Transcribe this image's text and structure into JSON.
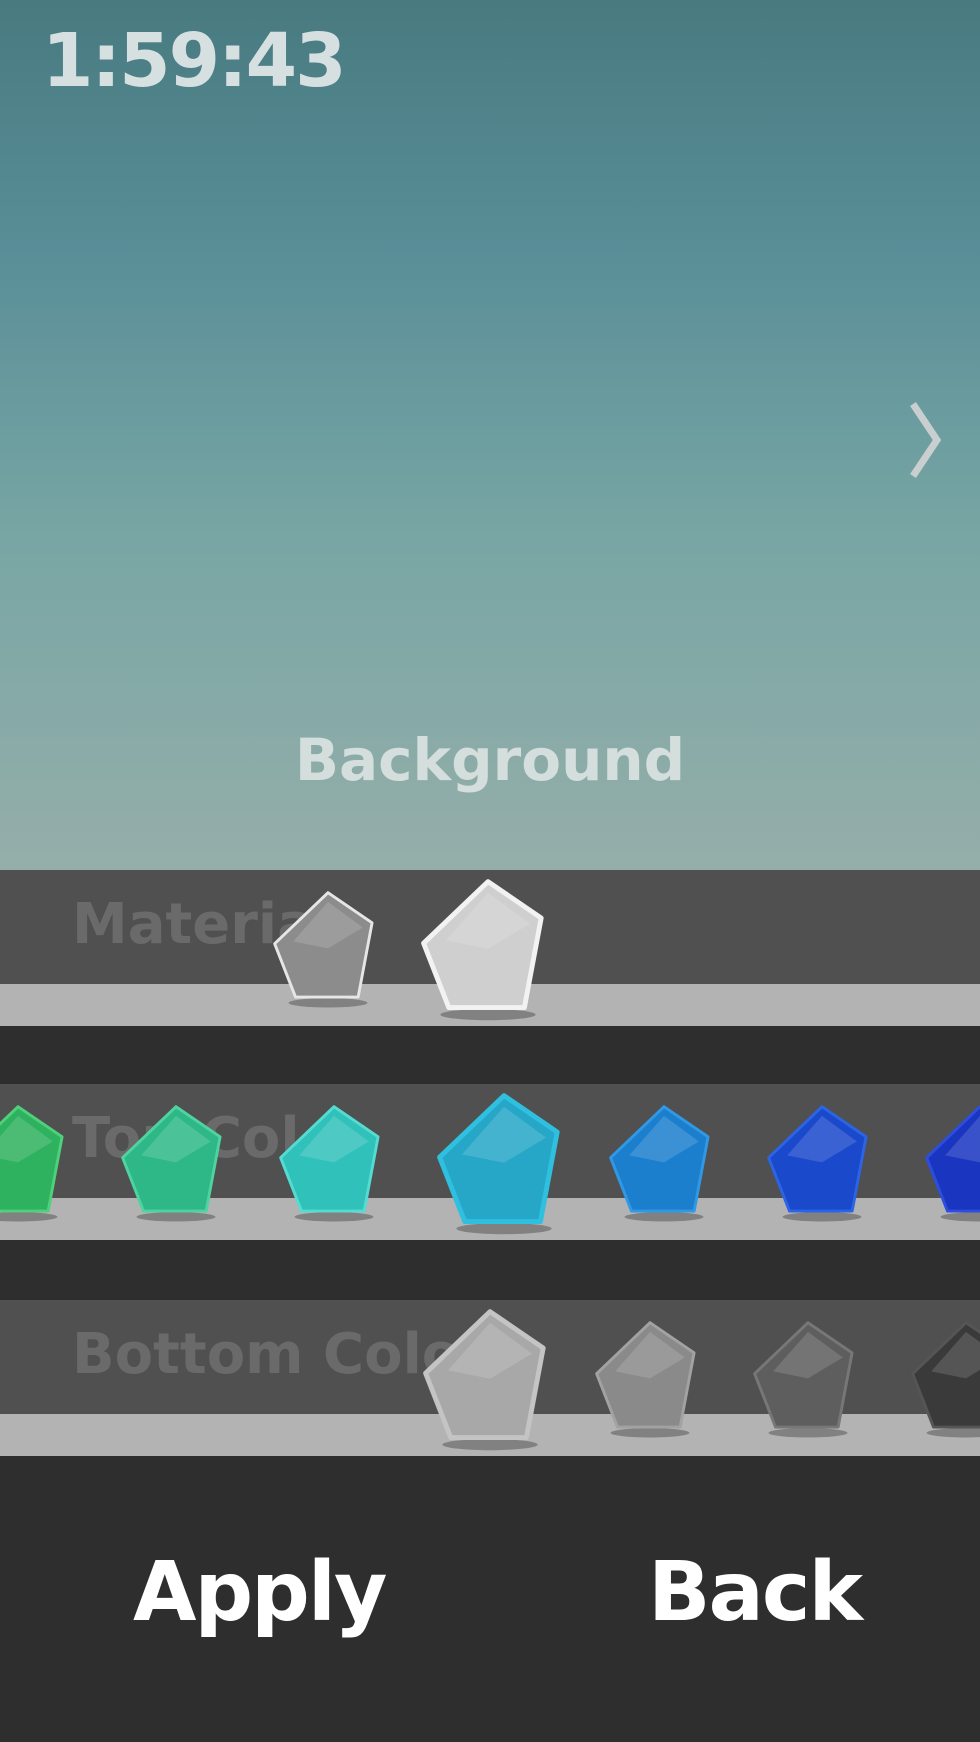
{
  "timer": "1:59:43",
  "section_title": "Background",
  "rows": {
    "material": {
      "label": "Materia",
      "selected_index": 1,
      "swatches": [
        {
          "name": "fabric",
          "color": "#8c8c8c",
          "edge": "#e6e6e6"
        },
        {
          "name": "stone",
          "color": "#cfcfcf",
          "edge": "#f2f2f2"
        }
      ]
    },
    "top_color": {
      "label": "Top Col",
      "selected_index": 3,
      "swatches": [
        {
          "name": "green",
          "color": "#2fb25f",
          "edge": "#4fd07a"
        },
        {
          "name": "mint",
          "color": "#2eb887",
          "edge": "#4fd3a0"
        },
        {
          "name": "turquoise",
          "color": "#31c1bb",
          "edge": "#55dcd2"
        },
        {
          "name": "teal-blue",
          "color": "#26a7c7",
          "edge": "#2fc0e0"
        },
        {
          "name": "ocean-blue",
          "color": "#1c7fce",
          "edge": "#2f99e6"
        },
        {
          "name": "royal-blue",
          "color": "#1a49cc",
          "edge": "#2c64e6"
        },
        {
          "name": "indigo",
          "color": "#1a36c0",
          "edge": "#2c4ee0"
        }
      ]
    },
    "bottom_color": {
      "label": "Bottom Colo",
      "selected_index": 0,
      "swatches": [
        {
          "name": "light-gray",
          "color": "#a8a8a8",
          "edge": "#c4c4c4"
        },
        {
          "name": "gray",
          "color": "#8a8a8a",
          "edge": "#a2a2a2"
        },
        {
          "name": "dark-gray",
          "color": "#5e5e5e",
          "edge": "#777777"
        },
        {
          "name": "charcoal",
          "color": "#3a3a3a",
          "edge": "#555555"
        }
      ]
    }
  },
  "buttons": {
    "apply": "Apply",
    "back": "Back"
  },
  "colors": {
    "preview_top": "#487a80",
    "preview_bottom": "#95aeaa",
    "band": "#505050",
    "shelf": "#b3b3b3",
    "bar": "#2e2e2e"
  }
}
